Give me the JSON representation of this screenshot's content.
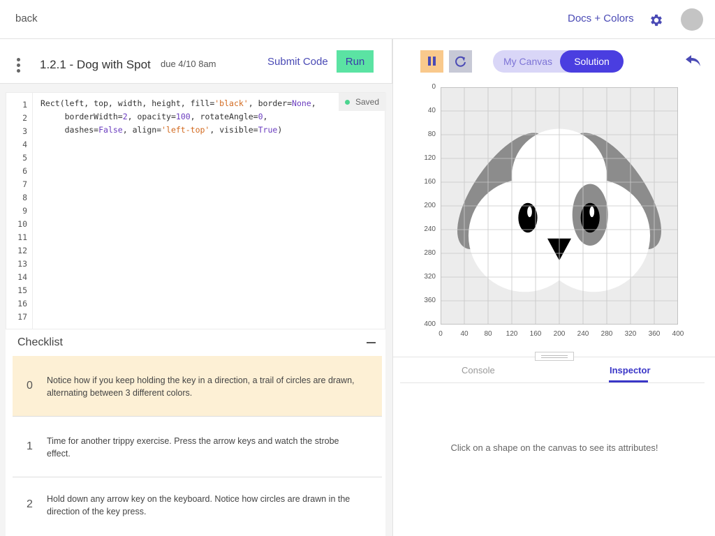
{
  "topbar": {
    "back": "back",
    "docs": "Docs + Colors"
  },
  "assignment": {
    "title": "1.2.1 - Dog with Spot",
    "due": "due 4/10 8am",
    "submit": "Submit Code",
    "run": "Run"
  },
  "editor": {
    "saved": "Saved",
    "line_numbers": [
      "1",
      "2",
      "3",
      "4",
      "5",
      "6",
      "7",
      "8",
      "9",
      "10",
      "11",
      "12",
      "13",
      "14",
      "15",
      "16",
      "17"
    ],
    "code_lines": [
      "Rect(left, top, width, height, fill='black', border=None,",
      "     borderWidth=2, opacity=100, rotateAngle=0,",
      "     dashes=False, align='left-top', visible=True)"
    ]
  },
  "checklist": {
    "title": "Checklist",
    "items": [
      {
        "num": "0",
        "text": "Notice how if you keep holding the key in a direction, a trail of circles are drawn, alternating between 3 different colors."
      },
      {
        "num": "1",
        "text": "Time for another trippy exercise. Press the arrow keys and watch the strobe effect."
      },
      {
        "num": "2",
        "text": "Hold down any arrow key on the keyboard. Notice how circles are drawn in the direction of the key press."
      }
    ]
  },
  "canvas": {
    "tabs": {
      "my": "My Canvas",
      "solution": "Solution"
    },
    "ticks": [
      "0",
      "40",
      "80",
      "120",
      "160",
      "200",
      "240",
      "280",
      "320",
      "360",
      "400"
    ]
  },
  "bottom": {
    "console": "Console",
    "inspector": "Inspector",
    "message": "Click on a shape on the canvas to see its attributes!"
  },
  "colors": {
    "accent": "#4a3ee0",
    "run": "#5be3a3",
    "highlight": "#fdf0d5",
    "pause": "#f9c98c"
  }
}
